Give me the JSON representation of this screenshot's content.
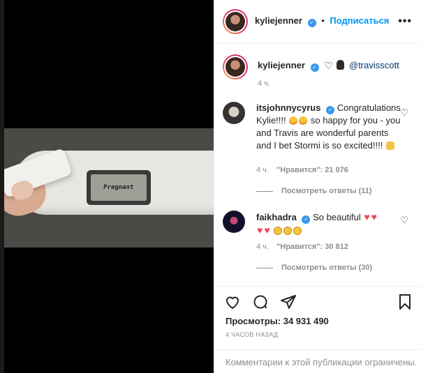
{
  "post_author": {
    "username": "kyliejenner",
    "verified": true,
    "follow_label": "Подписаться",
    "separator": "•"
  },
  "caption": {
    "username": "kyliejenner",
    "mention": "@travisscott",
    "time": "4 ч."
  },
  "media": {
    "screen_text": "Pregnant"
  },
  "comments": [
    {
      "username": "itsjohnnycyrus",
      "text_before": "Congratulations Kylie!!!!",
      "text_after": "so happy for you - you and Travis are wonderful parents and I bet Stormi is so excited!!!!",
      "time": "4 ч.",
      "likes": "\"Нравится\": 21 076",
      "replies": "Посмотреть ответы (11)"
    },
    {
      "username": "faikhadra",
      "text": "So beautiful",
      "time": "4 ч.",
      "likes": "\"Нравится\": 30 812",
      "replies": "Посмотреть ответы (30)"
    }
  ],
  "stats": {
    "views_label": "Просмотры:",
    "views_value": "34 931 490",
    "timestamp": "4 ЧАСОВ НАЗАД"
  },
  "comments_disabled": "Комментарии к этой публикации ограничены.",
  "colors": {
    "accent": "#0095f6",
    "verified": "#3897f0",
    "heart_red": "#ed4956",
    "muted": "#8e8e8e"
  }
}
